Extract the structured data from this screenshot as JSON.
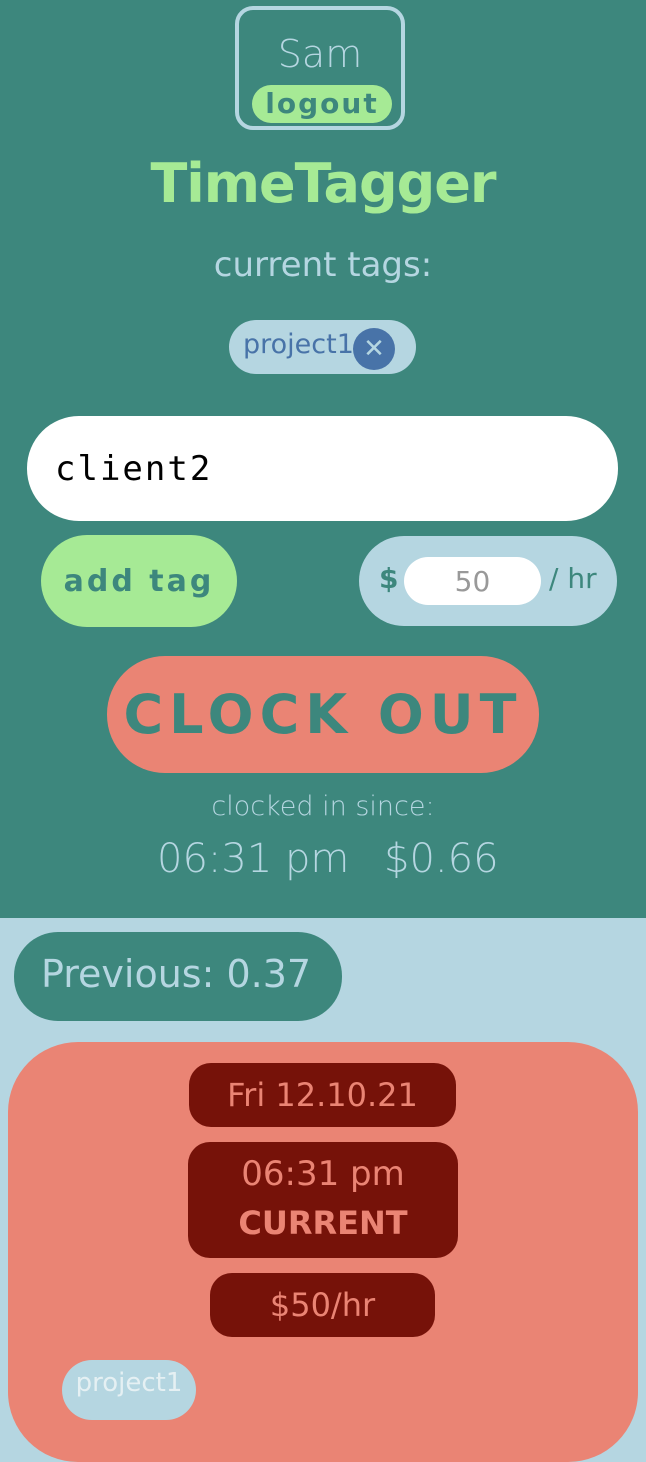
{
  "user": {
    "name": "Sam",
    "logout_label": "logout"
  },
  "app": {
    "title": "TimeTagger"
  },
  "current_tags": {
    "label": "current tags:",
    "tags": [
      {
        "name": "project1",
        "remove_icon": "close-icon"
      }
    ]
  },
  "tag_input": {
    "value": "client2",
    "placeholder": ""
  },
  "add_tag": {
    "label": "add tag"
  },
  "rate": {
    "currency_symbol": "$",
    "value": "50",
    "unit": "/ hr"
  },
  "clock": {
    "button_label": "CLOCK OUT",
    "since_label": "clocked in since:",
    "since_time": "06:31 pm",
    "earned": "$0.66"
  },
  "previous": {
    "label": "Previous: 0.37"
  },
  "entries": [
    {
      "date": "Fri 12.10.21",
      "time": "06:31 pm",
      "status": "CURRENT",
      "rate": "$50/hr",
      "tags": [
        "project1"
      ]
    }
  ],
  "colors": {
    "teal": "#3d877d",
    "light_blue": "#b5d6e1",
    "green": "#a6ea95",
    "salmon": "#ea8474",
    "dark_red": "#761209",
    "tag_blue": "#4873a8"
  }
}
